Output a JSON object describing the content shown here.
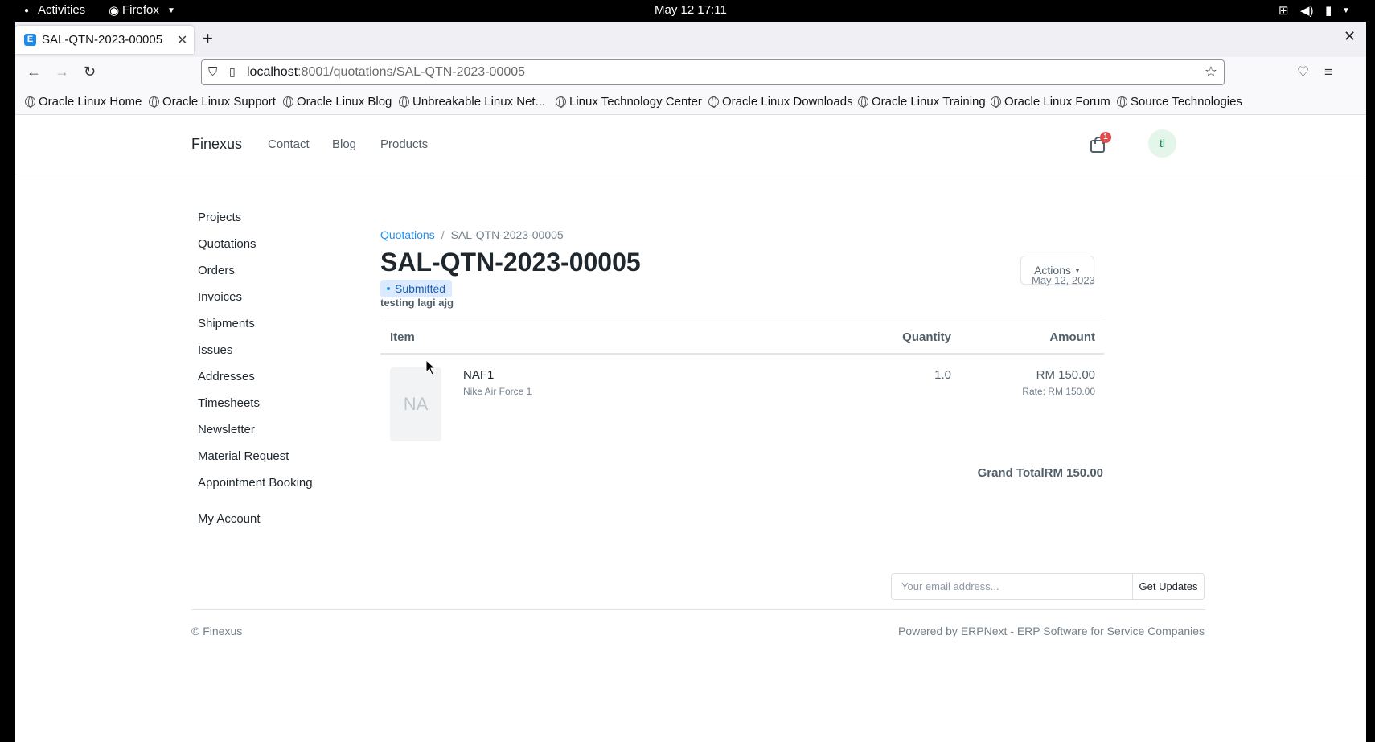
{
  "system_bar": {
    "activities": "Activities",
    "app": "Firefox",
    "clock": "May 12  17:11"
  },
  "browser": {
    "tab_title": "SAL-QTN-2023-00005",
    "url_host": "localhost",
    "url_rest": ":8001/quotations/SAL-QTN-2023-00005",
    "bookmarks": [
      "Oracle Linux Home",
      "Oracle Linux Support",
      "Oracle Linux Blog",
      "Unbreakable Linux Net...",
      "Linux Technology Center",
      "Oracle Linux Downloads",
      "Oracle Linux Training",
      "Oracle Linux Forum",
      "Source Technologies"
    ]
  },
  "header": {
    "brand": "Finexus",
    "nav": [
      "Contact",
      "Blog",
      "Products"
    ],
    "cart_count": "1",
    "avatar_initials": "tl"
  },
  "sidebar": {
    "items": [
      "Projects",
      "Quotations",
      "Orders",
      "Invoices",
      "Shipments",
      "Issues",
      "Addresses",
      "Timesheets",
      "Newsletter",
      "Material Request",
      "Appointment Booking"
    ],
    "my_account": "My Account"
  },
  "doc": {
    "breadcrumb_parent": "Quotations",
    "breadcrumb_sep": "/",
    "breadcrumb_current": "SAL-QTN-2023-00005",
    "title": "SAL-QTN-2023-00005",
    "status": "Submitted",
    "actions_label": "Actions",
    "date": "May 12, 2023",
    "subtitle": "testing lagi ajg",
    "columns": {
      "item": "Item",
      "quantity": "Quantity",
      "amount": "Amount"
    },
    "items": [
      {
        "thumb": "NA",
        "code": "NAF1",
        "name": "Nike Air Force 1",
        "quantity": "1.0",
        "amount": "RM 150.00",
        "rate": "Rate: RM 150.00"
      }
    ],
    "grand_total_label": "Grand Total",
    "grand_total_value": "RM 150.00"
  },
  "footer": {
    "email_placeholder": "Your email address...",
    "subscribe_label": "Get Updates",
    "copyright": "© Finexus",
    "powered_by": "Powered by ERPNext - ERP Software for Service Companies"
  },
  "colors": {
    "accent": "#2490ef",
    "status_bg": "#dbeafe",
    "badge": "#e24c4c"
  }
}
